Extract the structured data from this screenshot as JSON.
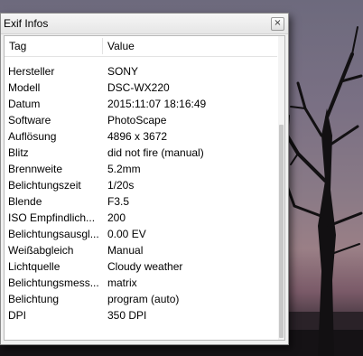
{
  "window": {
    "title": "Exif Infos",
    "close_glyph": "×"
  },
  "columns": {
    "tag": "Tag",
    "value": "Value"
  },
  "rows": [
    {
      "tag": "Hersteller",
      "value": "SONY"
    },
    {
      "tag": "Modell",
      "value": "DSC-WX220"
    },
    {
      "tag": "Datum",
      "value": "2015:11:07 18:16:49"
    },
    {
      "tag": "Software",
      "value": "PhotoScape"
    },
    {
      "tag": "Auflösung",
      "value": "4896 x 3672"
    },
    {
      "tag": "Blitz",
      "value": "did not fire (manual)"
    },
    {
      "tag": "Brennweite",
      "value": "5.2mm"
    },
    {
      "tag": "Belichtungszeit",
      "value": "1/20s"
    },
    {
      "tag": "Blende",
      "value": "F3.5"
    },
    {
      "tag": "ISO Empfindlich...",
      "value": "200"
    },
    {
      "tag": "Belichtungsausgl...",
      "value": "0.00 EV"
    },
    {
      "tag": "Weißabgleich",
      "value": "Manual"
    },
    {
      "tag": "Lichtquelle",
      "value": "Cloudy weather"
    },
    {
      "tag": "Belichtungsmess...",
      "value": "matrix"
    },
    {
      "tag": "Belichtung",
      "value": "program (auto)"
    },
    {
      "tag": "DPI",
      "value": "350 DPI"
    }
  ]
}
